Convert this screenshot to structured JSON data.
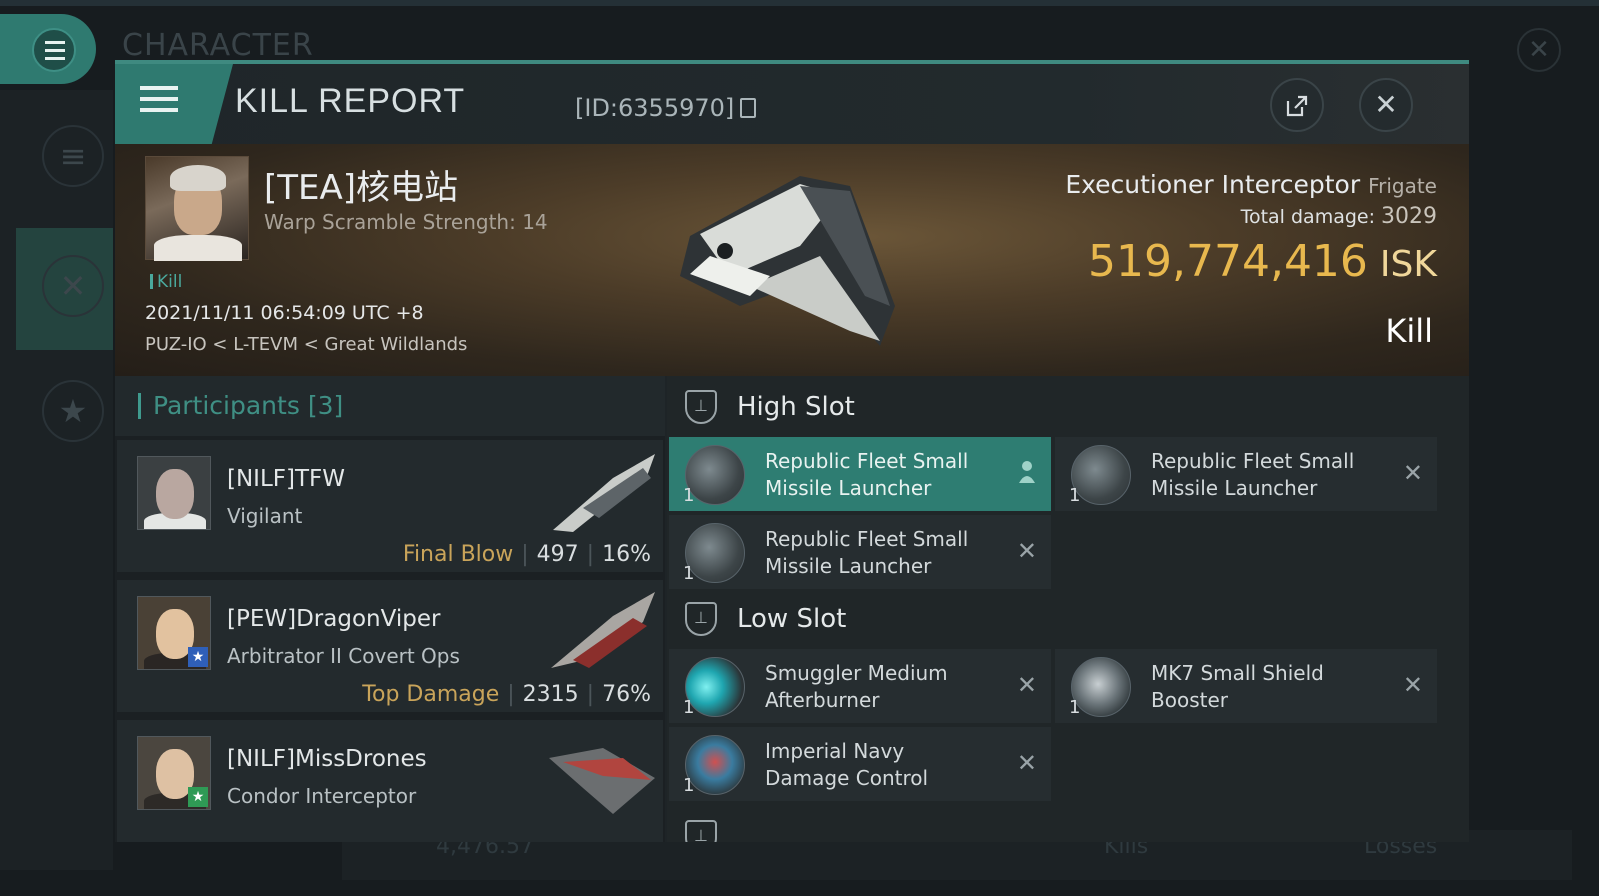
{
  "background": {
    "title": "CHARACTER",
    "bottom_value": "4,476.57",
    "bottom_kills": "Kills",
    "bottom_losses": "Losses"
  },
  "header": {
    "title": "KILL REPORT",
    "id_text": "[ID:6355970]",
    "share_icon": "share-icon",
    "close_icon": "close-icon"
  },
  "victim": {
    "name": "[TEA]核电站",
    "warp_scramble": "Warp Scramble Strength: 14",
    "tag": "Kill",
    "timestamp": "2021/11/11 06:54:09 UTC +8",
    "location": "PUZ-IO < L-TEVM < Great Wildlands",
    "ship": "Executioner Interceptor",
    "ship_class": "Frigate",
    "total_damage_label": "Total damage:",
    "total_damage": "3029",
    "isk_value": "519,774,416",
    "isk_unit": "ISK",
    "result": "Kill"
  },
  "participants": {
    "heading": "Participants",
    "count": "[3]",
    "rows": [
      {
        "name": "[NILF]TFW",
        "ship": "Vigilant",
        "role": "Final Blow",
        "damage": "497",
        "percent": "16%"
      },
      {
        "name": "[PEW]DragonViper",
        "ship": "Arbitrator II Covert Ops",
        "role": "Top Damage",
        "damage": "2315",
        "percent": "76%"
      },
      {
        "name": "[NILF]MissDrones",
        "ship": "Condor Interceptor",
        "role": "",
        "damage": "",
        "percent": ""
      }
    ]
  },
  "fitting": {
    "high_slot": {
      "label": "High Slot",
      "modules": [
        {
          "name_line1": "Republic Fleet Small",
          "name_line2": "Missile Launcher",
          "qty": "1"
        },
        {
          "name_line1": "Republic Fleet Small",
          "name_line2": "Missile Launcher",
          "qty": "1"
        },
        {
          "name_line1": "Republic Fleet Small",
          "name_line2": "Missile Launcher",
          "qty": "1"
        }
      ]
    },
    "low_slot": {
      "label": "Low Slot",
      "modules": [
        {
          "name_line1": "Smuggler Medium",
          "name_line2": "Afterburner",
          "qty": "1"
        },
        {
          "name_line1": "MK7 Small Shield",
          "name_line2": "Booster",
          "qty": "1"
        },
        {
          "name_line1": "Imperial Navy",
          "name_line2": "Damage Control",
          "qty": "1"
        }
      ]
    }
  },
  "colors": {
    "accent": "#2f7a70",
    "isk": "#e8b84e",
    "role_label": "#c9a45a"
  }
}
